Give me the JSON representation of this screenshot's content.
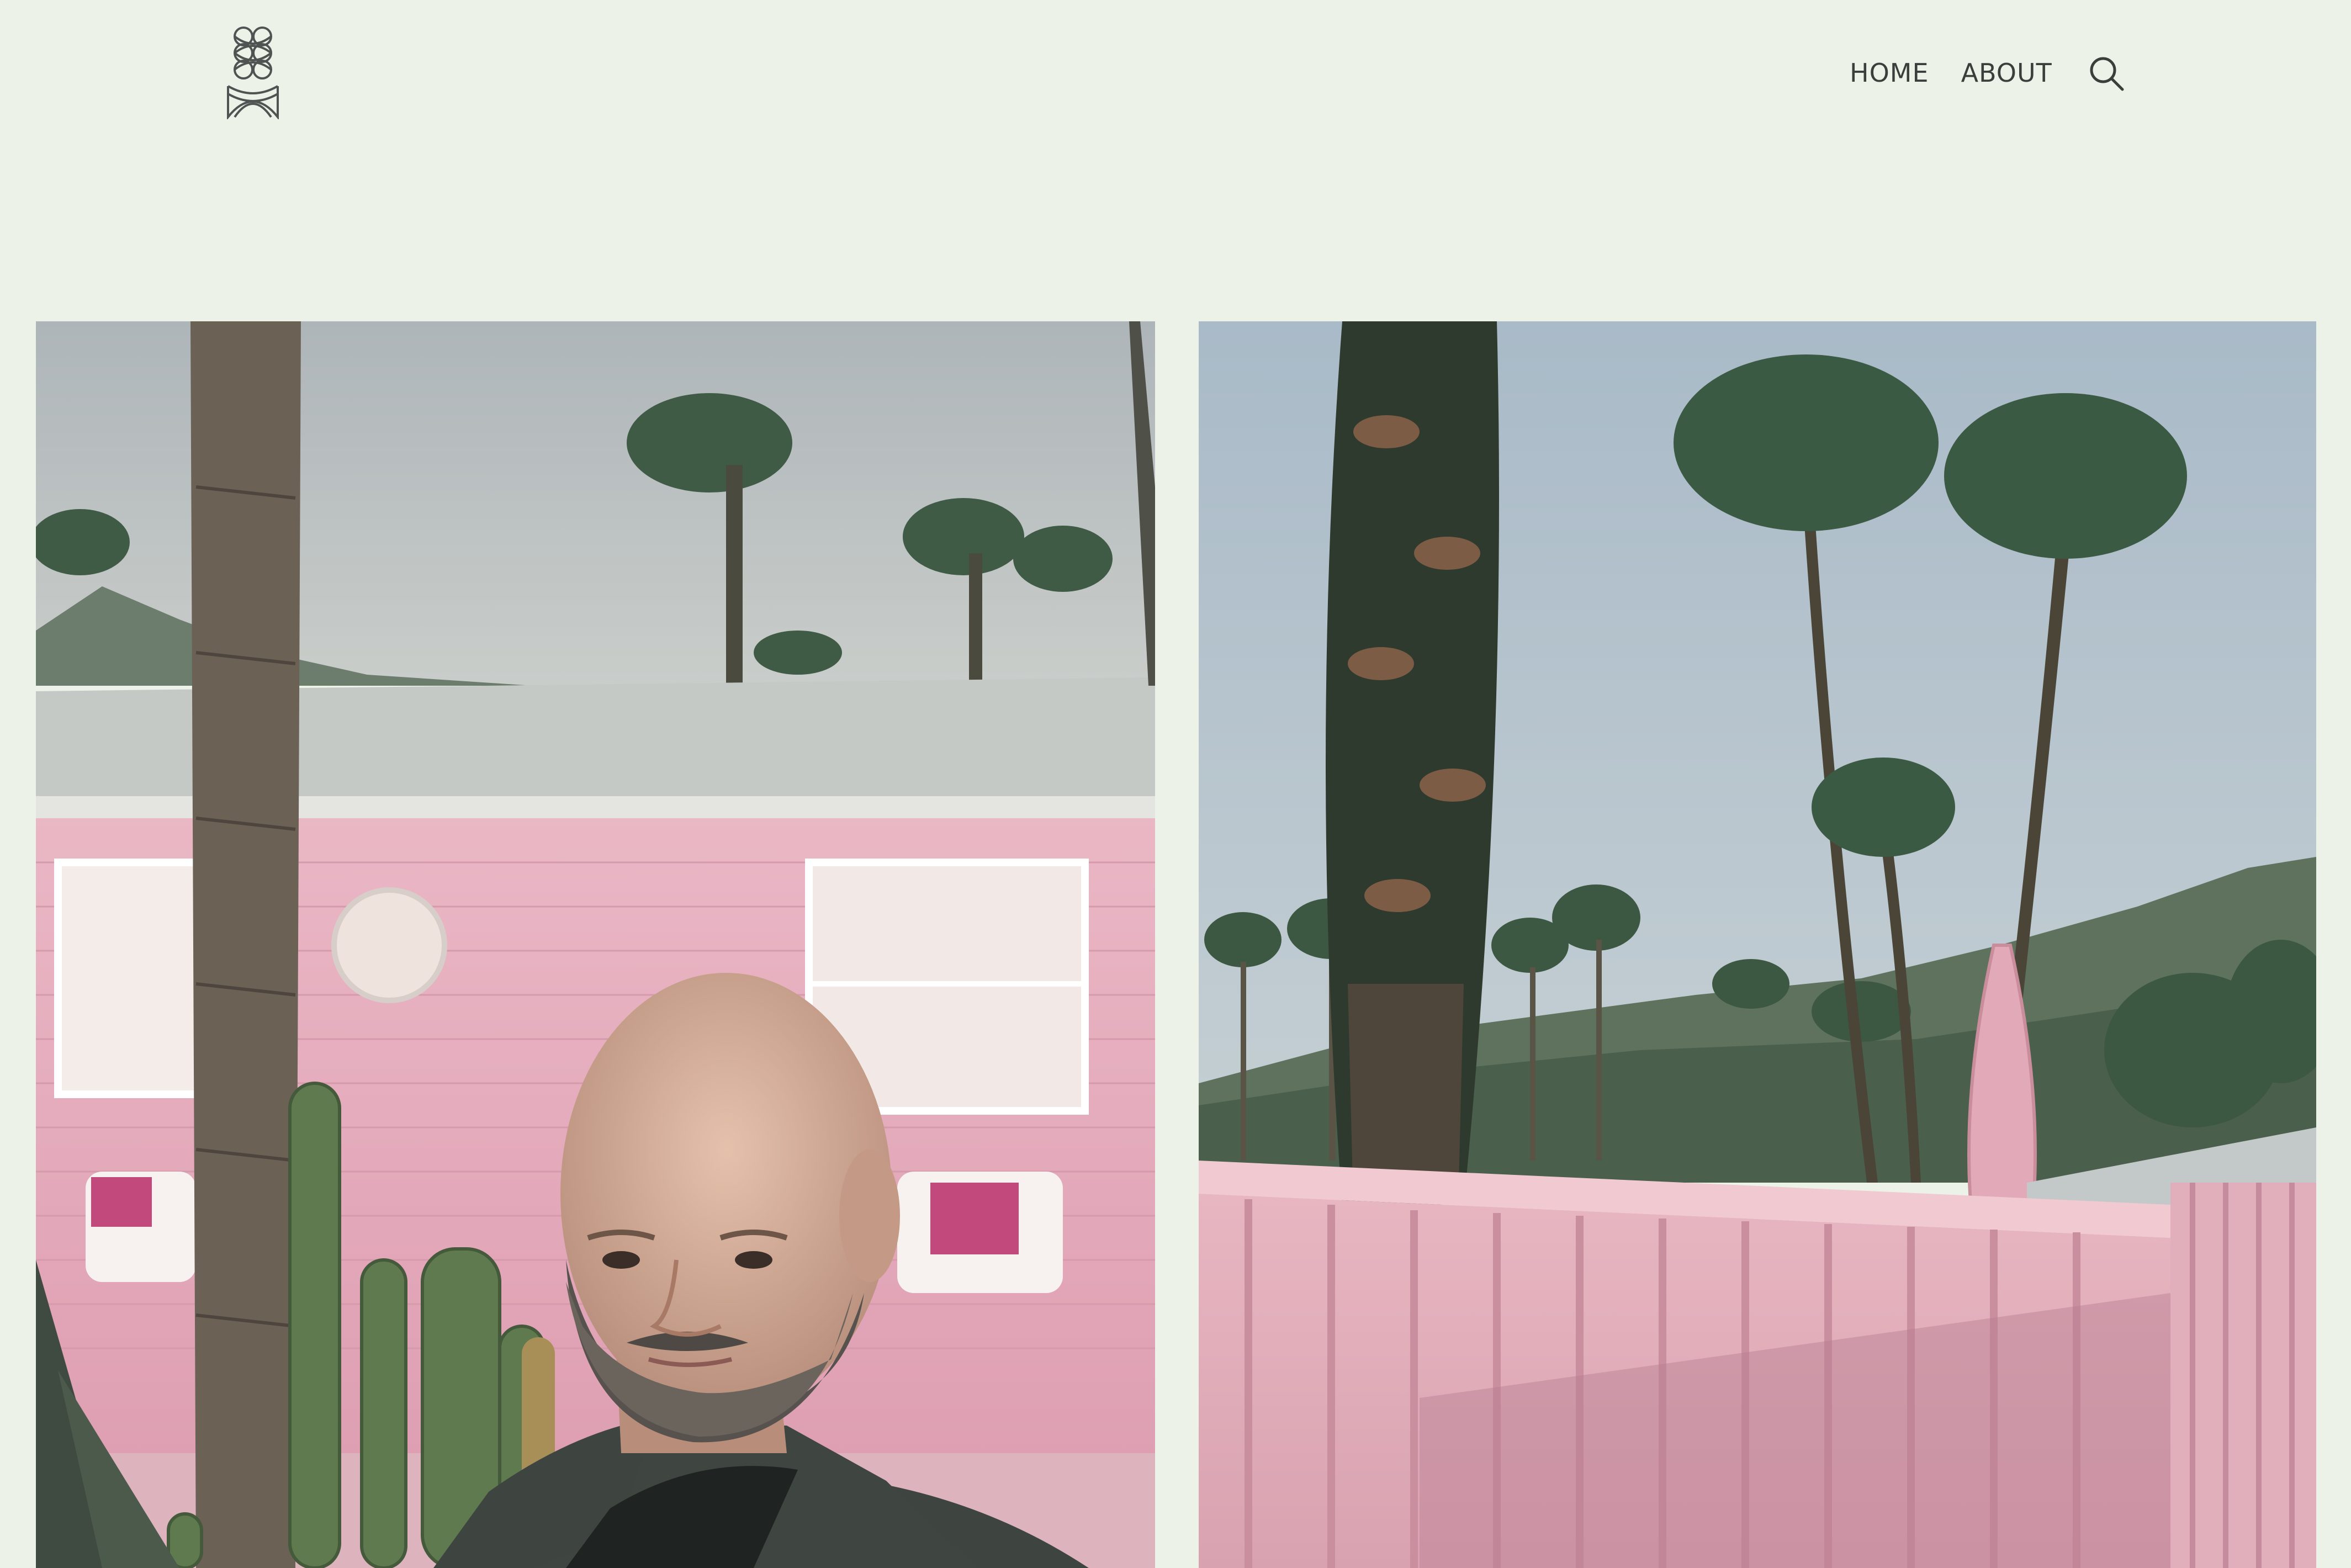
{
  "site": {
    "logo_icon": "celtic-knot-icon",
    "brand_color": "#3a3f3c",
    "background": "#edf2e8"
  },
  "nav": {
    "items": [
      {
        "label": "HOME"
      },
      {
        "label": "ABOUT"
      }
    ],
    "search_icon": "search-icon"
  },
  "gallery": {
    "photos": [
      {
        "subject": "selfie-pink-motel-cacti",
        "accent": "#e8a3b6"
      },
      {
        "subject": "pink-railing-palm-trees",
        "accent": "#e7b5c0"
      }
    ]
  }
}
